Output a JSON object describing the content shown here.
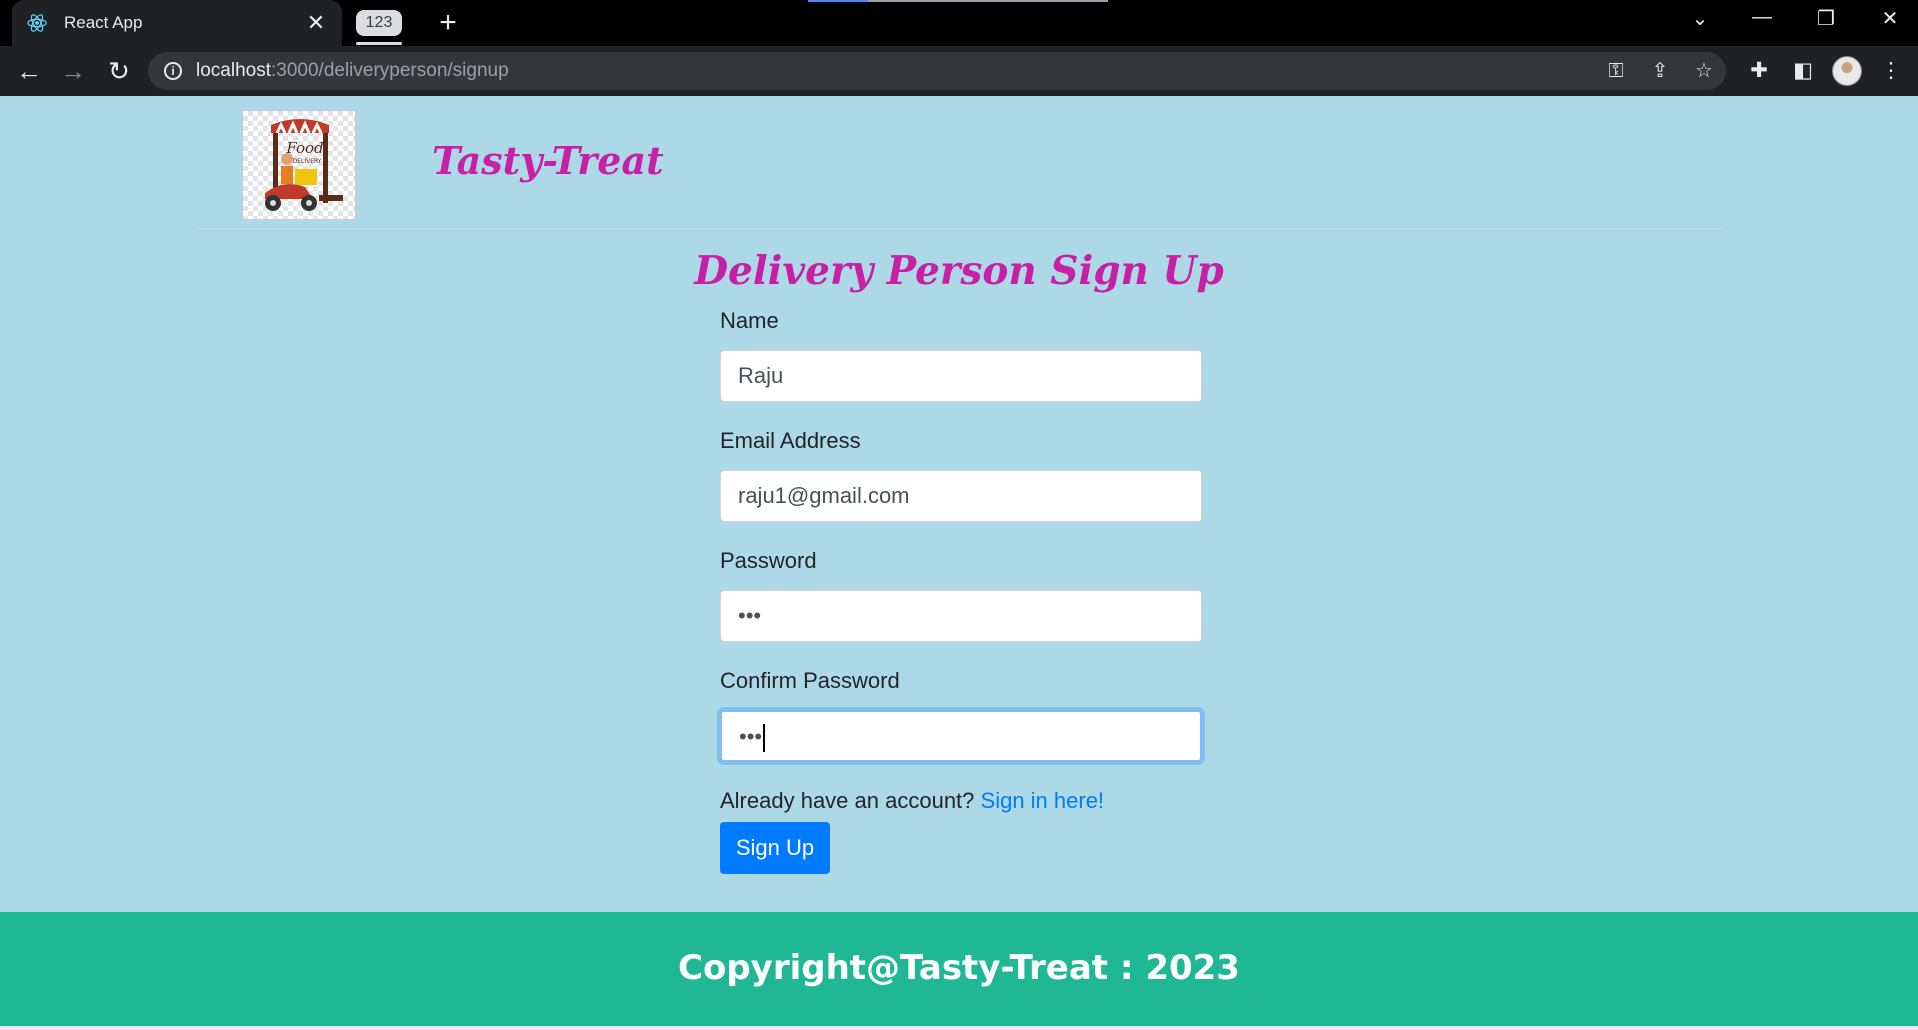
{
  "browser": {
    "tab_title": "React App",
    "tab_group_label": "123",
    "url_host": "localhost",
    "url_path": ":3000/deliveryperson/signup"
  },
  "navbar": {
    "brand": "Tasty-Treat",
    "logo_text_top": "Food",
    "logo_text_bottom": "DELIVERY"
  },
  "form": {
    "heading": "Delivery Person Sign Up",
    "name_label": "Name",
    "name_value": "Raju",
    "email_label": "Email Address",
    "email_value": "raju1@gmail.com",
    "password_label": "Password",
    "password_value": "•••",
    "confirm_label": "Confirm Password",
    "confirm_value": "•••",
    "already_text": "Already have an account? ",
    "signin_link": "Sign in here!",
    "submit_label": "Sign Up"
  },
  "footer": {
    "copyright": "Copyright@Tasty-Treat : 2023"
  },
  "colors": {
    "page_bg": "#add8e6",
    "brand": "#c71fa5",
    "footer_bg": "#20b794",
    "primary": "#007bff"
  }
}
